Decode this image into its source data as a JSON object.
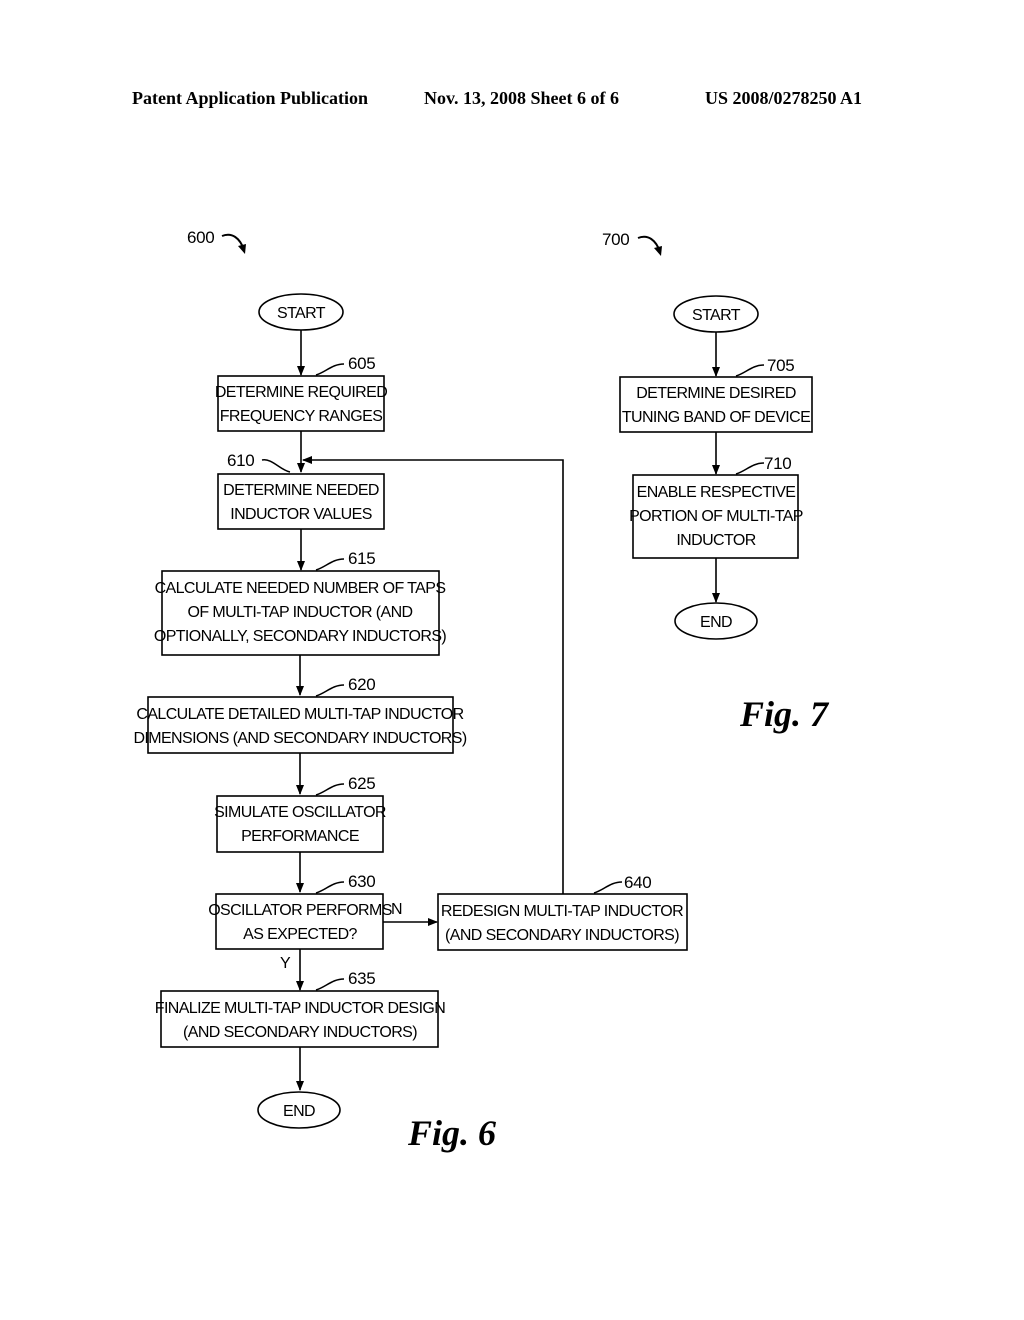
{
  "header": {
    "left": "Patent Application Publication",
    "middle": "Nov. 13, 2008   Sheet 6 of 6",
    "right": "US 2008/0278250 A1"
  },
  "fig6": {
    "ref": "600",
    "caption": "Fig. 6",
    "start": "START",
    "end": "END",
    "steps": [
      {
        "id": "605",
        "lines": [
          "DETERMINE REQUIRED",
          "FREQUENCY RANGES"
        ]
      },
      {
        "id": "610",
        "lines": [
          "DETERMINE NEEDED",
          "INDUCTOR VALUES"
        ]
      },
      {
        "id": "615",
        "lines": [
          "CALCULATE NEEDED NUMBER OF TAPS",
          "OF MULTI-TAP INDUCTOR (AND",
          "OPTIONALLY, SECONDARY INDUCTORS)"
        ]
      },
      {
        "id": "620",
        "lines": [
          "CALCULATE DETAILED MULTI-TAP INDUCTOR",
          "DIMENSIONS (AND SECONDARY INDUCTORS)"
        ]
      },
      {
        "id": "625",
        "lines": [
          "SIMULATE OSCILLATOR",
          "PERFORMANCE"
        ]
      },
      {
        "id": "630",
        "lines": [
          "OSCILLATOR PERFORMS",
          "AS EXPECTED?"
        ]
      },
      {
        "id": "635",
        "lines": [
          "FINALIZE MULTI-TAP INDUCTOR DESIGN",
          "(AND SECONDARY INDUCTORS)"
        ]
      },
      {
        "id": "640",
        "lines": [
          "REDESIGN MULTI-TAP INDUCTOR",
          "(AND SECONDARY INDUCTORS)"
        ]
      }
    ],
    "branch_no": "N",
    "branch_yes": "Y"
  },
  "fig7": {
    "ref": "700",
    "caption": "Fig. 7",
    "start": "START",
    "end": "END",
    "steps": [
      {
        "id": "705",
        "lines": [
          "DETERMINE DESIRED",
          "TUNING BAND OF DEVICE"
        ]
      },
      {
        "id": "710",
        "lines": [
          "ENABLE RESPECTIVE",
          "PORTION OF MULTI-TAP",
          "INDUCTOR"
        ]
      }
    ]
  }
}
